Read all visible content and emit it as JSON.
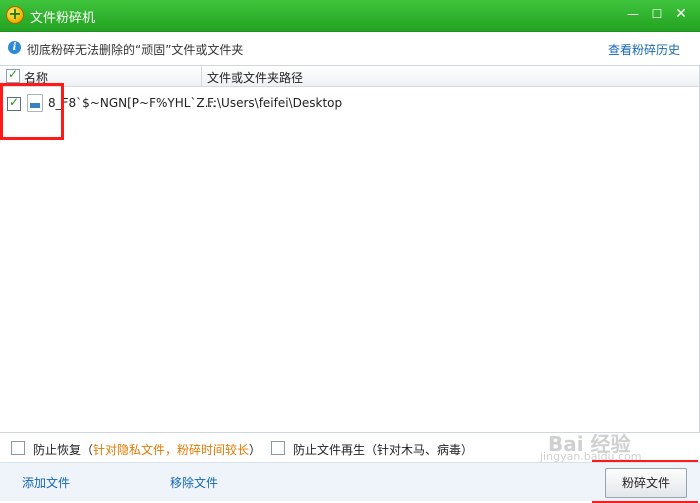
{
  "window": {
    "title": "文件粉碎机",
    "minimize_glyph": "—",
    "maximize_glyph": "☐",
    "close_glyph": "✕"
  },
  "infobar": {
    "icon": "info-icon",
    "icon_glyph": "i",
    "text": "彻底粉碎无法删除的“顽固”文件或文件夹",
    "history_link": "查看粉碎历史"
  },
  "list": {
    "columns": [
      "名称",
      "文件或文件夹路径"
    ],
    "header_checked": true,
    "rows": [
      {
        "checked": true,
        "icon": "jpg-file-icon",
        "name": "8_F8`$~NGN[P~F%YHL`Z...",
        "path": "F:\\Users\\feifei\\Desktop"
      }
    ]
  },
  "options": {
    "prevent_recovery_label": "防止恢复（",
    "prevent_recovery_note": "针对隐私文件，粉碎时间较长",
    "prevent_recovery_close": "）",
    "prevent_regen_label": "防止文件再生（针对木马、病毒）",
    "prevent_recovery_checked": false,
    "prevent_regen_checked": false
  },
  "footer": {
    "add_file": "添加文件",
    "remove_file": "移除文件",
    "shred_button": "粉碎文件"
  },
  "watermark": {
    "text": "Bai 经验",
    "sub": "jingyan.baidu.com"
  }
}
